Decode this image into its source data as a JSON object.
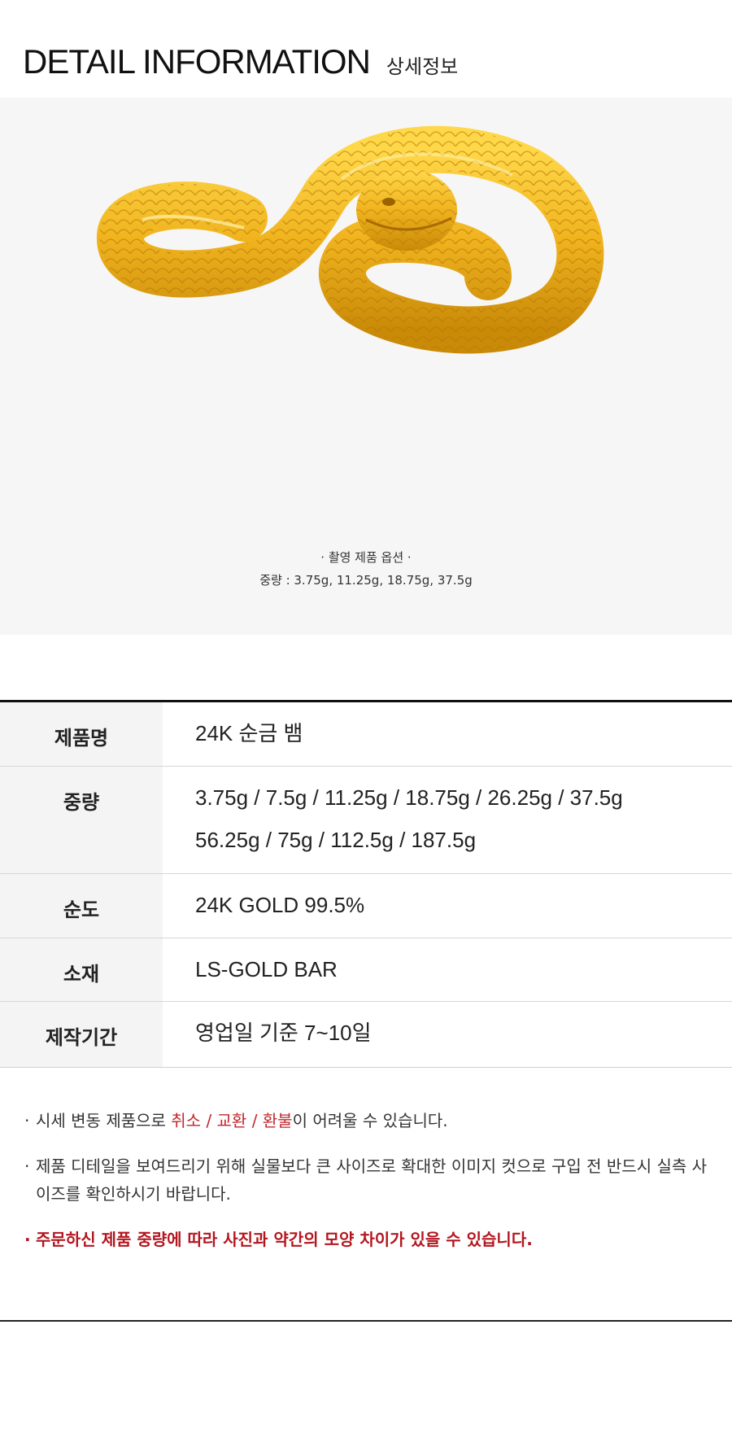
{
  "header": {
    "title_en": "DETAIL INFORMATION",
    "title_ko": "상세정보"
  },
  "photo": {
    "caption_line1": "· 촬영 제품 옵션 ·",
    "caption_line2": "중량 : 3.75g, 11.25g, 18.75g, 37.5g",
    "gold_color": "#e6a61a"
  },
  "spec_table": {
    "rows": [
      {
        "label": "제품명",
        "values": [
          "24K 순금 뱀"
        ]
      },
      {
        "label": "중량",
        "values": [
          "3.75g / 7.5g / 11.25g / 18.75g / 26.25g / 37.5g",
          "56.25g / 75g / 112.5g / 187.5g"
        ]
      },
      {
        "label": "순도",
        "values": [
          "24K GOLD 99.5%"
        ]
      },
      {
        "label": "소재",
        "values": [
          "LS-GOLD BAR"
        ]
      },
      {
        "label": "제작기간",
        "values": [
          "영업일 기준 7~10일"
        ]
      }
    ]
  },
  "notes": {
    "note1_prefix": "시세 변동 제품으로 ",
    "note1_red": "취소 / 교환 /  환불",
    "note1_suffix": "이 어려울 수 있습니다.",
    "note2": "제품 디테일을 보여드리기 위해 실물보다 큰 사이즈로 확대한 이미지 컷으로 구입 전 반드시 실측 사이즈를 확인하시기 바랍니다.",
    "note3": "주문하신 제품 중량에 따라 사진과 약간의 모양 차이가 있을 수 있습니다.",
    "bullet": "·"
  }
}
